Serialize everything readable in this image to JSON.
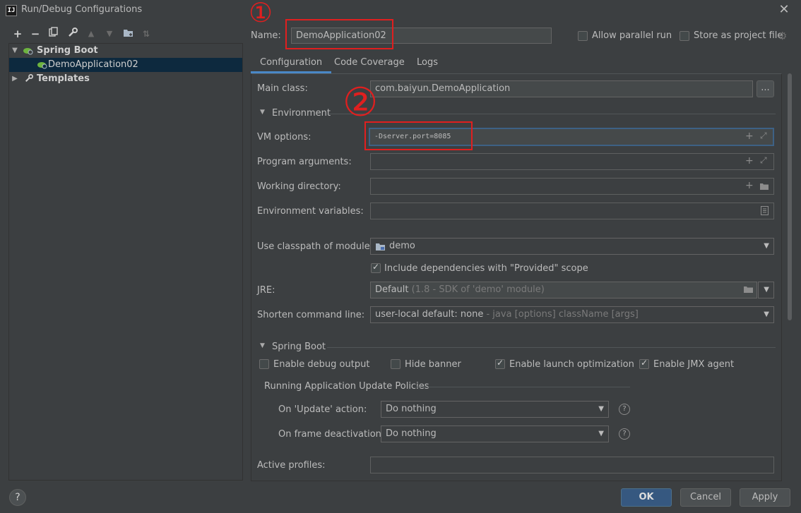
{
  "window": {
    "title": "Run/Debug Configurations"
  },
  "toolbar": {
    "add": "+",
    "remove": "−",
    "copy": "⧉",
    "edit": "🔧",
    "up": "▲",
    "down": "▼",
    "folder": "📁",
    "sort": "⇅"
  },
  "tree": {
    "spring_boot": "Spring Boot",
    "config_item": "DemoApplication02",
    "templates": "Templates"
  },
  "header": {
    "name_label": "Name:",
    "name_value": "DemoApplication02",
    "parallel_label": "Allow parallel run",
    "store_label": "Store as project file"
  },
  "tabs": [
    "Configuration",
    "Code Coverage",
    "Logs"
  ],
  "form": {
    "main_class_label": "Main class:",
    "main_class_value": "com.baiyun.DemoApplication",
    "browse": "...",
    "environment_section": "Environment",
    "vm_label": "VM options:",
    "vm_value": "-Dserver.port=8085",
    "program_args_label": "Program arguments:",
    "working_dir_label": "Working directory:",
    "env_vars_label": "Environment variables:",
    "classpath_label": "Use classpath of module:",
    "classpath_value": "demo",
    "include_deps_label": "Include dependencies with \"Provided\" scope",
    "jre_label": "JRE:",
    "jre_value": "Default",
    "jre_hint": "(1.8 - SDK of 'demo' module)",
    "shorten_label": "Shorten command line:",
    "shorten_value": "user-local default: none",
    "shorten_hint": "- java [options] className [args]"
  },
  "spring_boot_section": {
    "title": "Spring Boot",
    "debug_output": "Enable debug output",
    "hide_banner": "Hide banner",
    "launch_opt": "Enable launch optimization",
    "jmx_agent": "Enable JMX agent",
    "policies_title": "Running Application Update Policies",
    "on_update_label": "On 'Update' action:",
    "on_update_value": "Do nothing",
    "on_frame_label": "On frame deactivation:",
    "on_frame_value": "Do nothing",
    "active_profiles_label": "Active profiles:"
  },
  "buttons": {
    "help": "?",
    "ok": "OK",
    "cancel": "Cancel",
    "apply": "Apply"
  },
  "annotations": {
    "circle1": "①",
    "circle2": "②"
  },
  "colors": {
    "accent": "#4a88c7",
    "annotation_red": "#e01f1f",
    "primary_button": "#365880",
    "spring_green": "#6db33f"
  }
}
